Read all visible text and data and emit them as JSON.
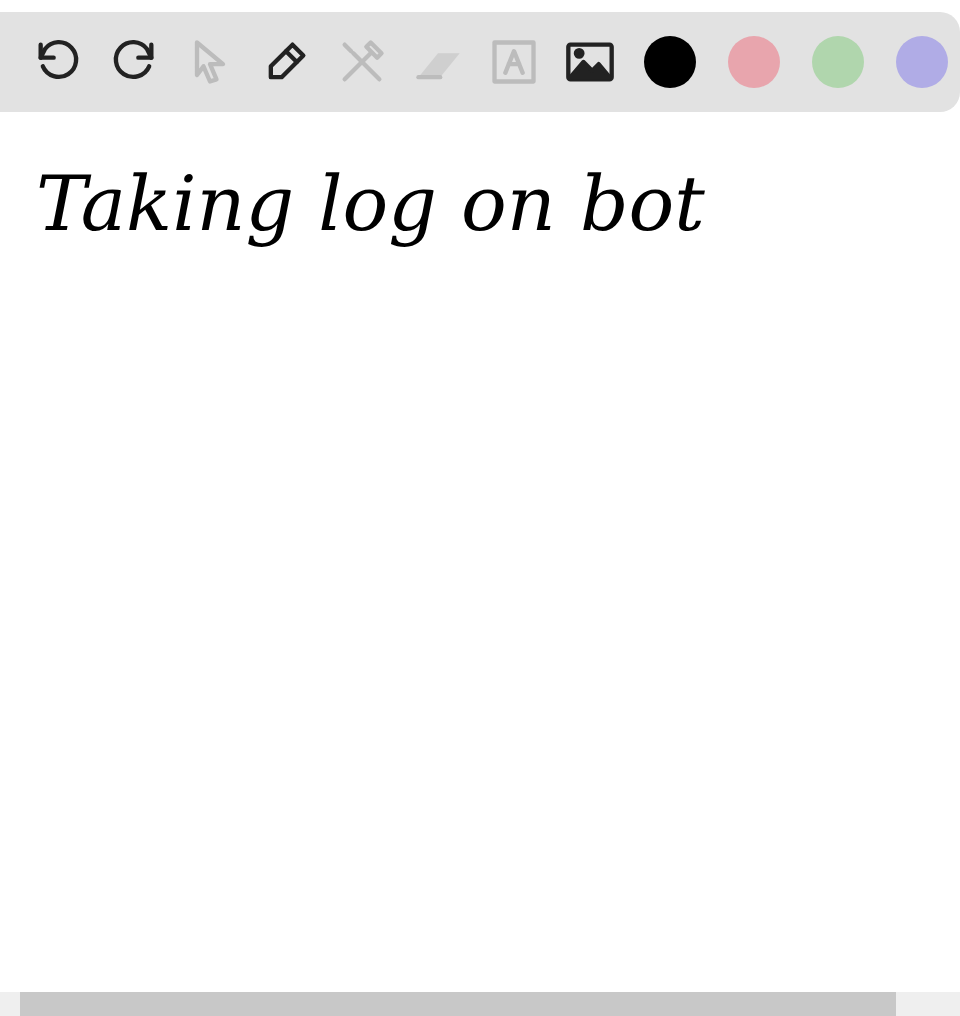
{
  "toolbar": {
    "tools": [
      {
        "kind": "undo",
        "disabled": false
      },
      {
        "kind": "redo",
        "disabled": false
      },
      {
        "kind": "pointer",
        "disabled": true
      },
      {
        "kind": "pen",
        "disabled": false
      },
      {
        "kind": "tools",
        "disabled": true
      },
      {
        "kind": "eraser",
        "disabled": true
      },
      {
        "kind": "text",
        "disabled": true
      },
      {
        "kind": "image",
        "disabled": false
      }
    ],
    "colors": [
      {
        "color": "#000000"
      },
      {
        "color": "#e8a5ad"
      },
      {
        "color": "#b0d6ad"
      },
      {
        "color": "#b0ace6"
      }
    ]
  },
  "canvas": {
    "handwriting": "Taking log on bot"
  }
}
